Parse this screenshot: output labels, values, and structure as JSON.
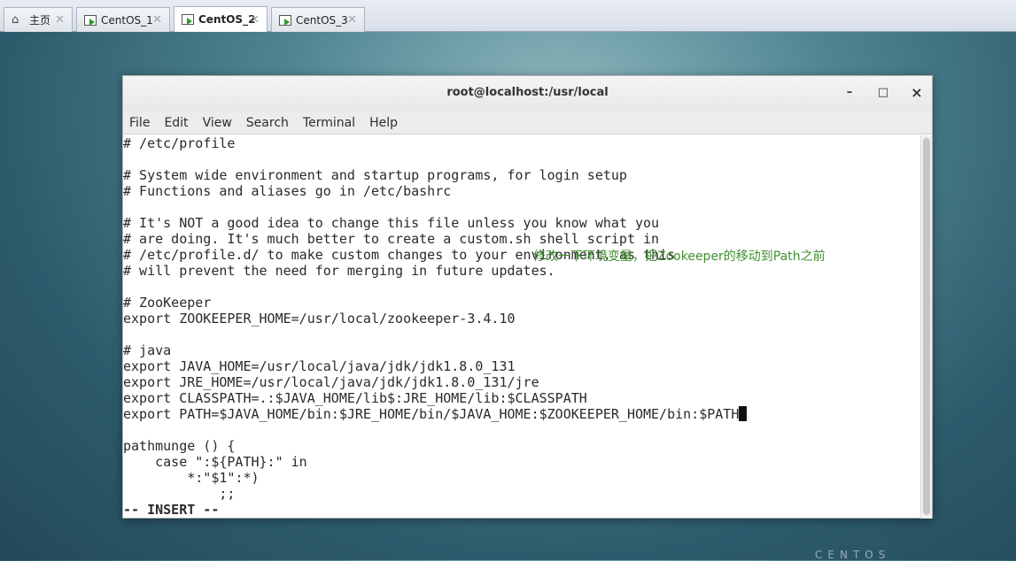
{
  "tabs": [
    {
      "label": "主页",
      "icon": "home-icon",
      "active": false
    },
    {
      "label": "CentOS_1",
      "icon": "vm-icon",
      "active": false
    },
    {
      "label": "CentOS_2",
      "icon": "vm-icon",
      "active": true
    },
    {
      "label": "CentOS_3",
      "icon": "vm-icon",
      "active": false
    }
  ],
  "window": {
    "title": "root@localhost:/usr/local",
    "minimize": "–",
    "maximize": "□",
    "close": "×"
  },
  "menu": [
    "File",
    "Edit",
    "View",
    "Search",
    "Terminal",
    "Help"
  ],
  "lines": [
    "# /etc/profile",
    "",
    "# System wide environment and startup programs, for login setup",
    "# Functions and aliases go in /etc/bashrc",
    "",
    "# It's NOT a good idea to change this file unless you know what you",
    "# are doing. It's much better to create a custom.sh shell script in",
    "# /etc/profile.d/ to make custom changes to your environment, as this",
    "# will prevent the need for merging in future updates.",
    "",
    "# ZooKeeper",
    "export ZOOKEEPER_HOME=/usr/local/zookeeper-3.4.10",
    "",
    "# java",
    "export JAVA_HOME=/usr/local/java/jdk/jdk1.8.0_131",
    "export JRE_HOME=/usr/local/java/jdk/jdk1.8.0_131/jre",
    "export CLASSPATH=.:$JAVA_HOME/lib$:JRE_HOME/lib:$CLASSPATH",
    "export PATH=$JAVA_HOME/bin:$JRE_HOME/bin/$JAVA_HOME:$ZOOKEEPER_HOME/bin:$PATH",
    "",
    "pathmunge () {",
    "    case \":${PATH}:\" in",
    "        *:\"$1\":*)",
    "            ;;",
    "-- INSERT --"
  ],
  "annotation": "修改一下环境变量，把Zookeeper的移动到Path之前",
  "colors": {
    "annotation": "#3f8f2f"
  },
  "desktop_logo": "CENTOS"
}
